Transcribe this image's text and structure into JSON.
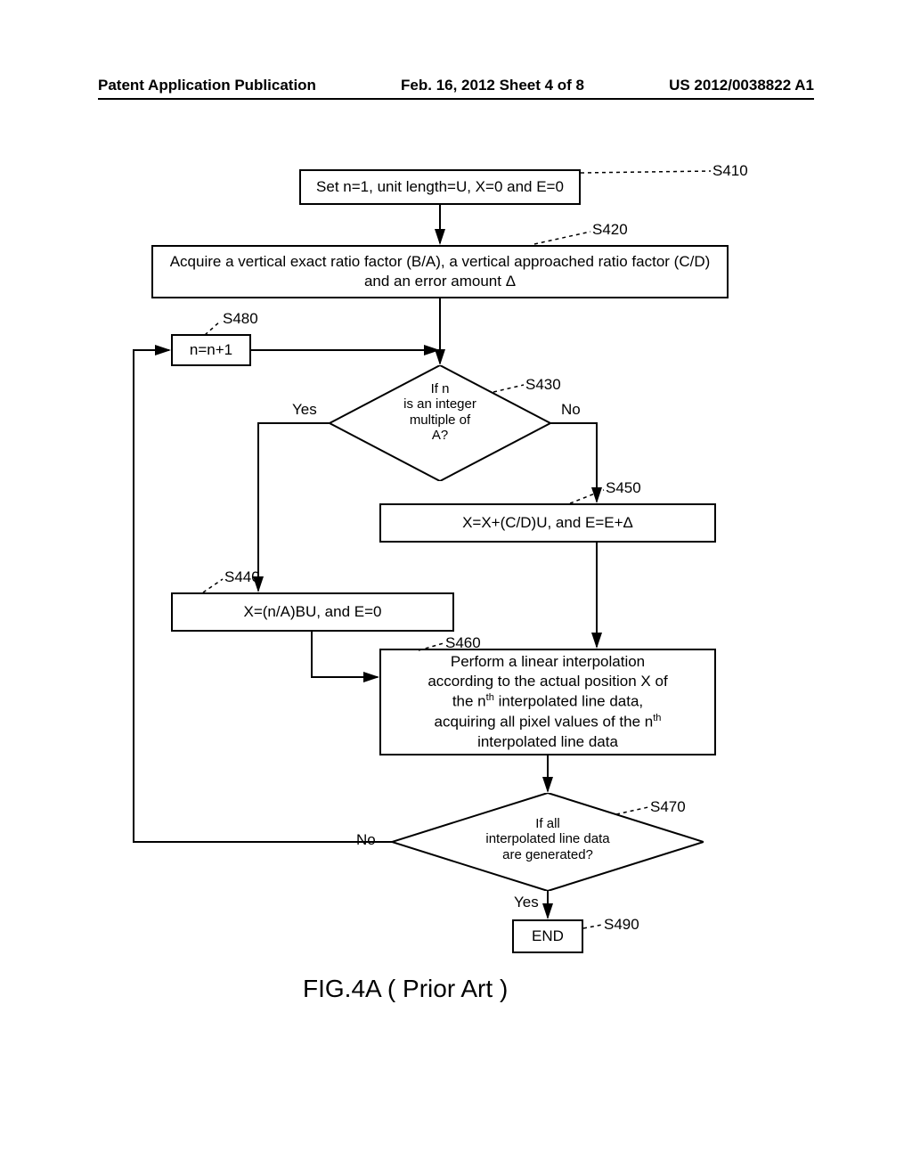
{
  "header": {
    "left": "Patent Application Publication",
    "center": "Feb. 16, 2012  Sheet 4 of 8",
    "right": "US 2012/0038822 A1"
  },
  "labels": {
    "s410": "S410",
    "s420": "S420",
    "s430": "S430",
    "s440": "S440",
    "s450": "S450",
    "s460": "S460",
    "s470": "S470",
    "s480": "S480",
    "s490": "S490"
  },
  "boxes": {
    "s410": "Set n=1, unit length=U, X=0 and E=0",
    "s420": "Acquire a vertical exact ratio factor (B/A), a vertical approached ratio factor (C/D) and an error amount Δ",
    "s440": "X=(n/A)BU, and E=0",
    "s450": "X=X+(C/D)U, and E=E+Δ",
    "s460_l1": "Perform a linear interpolation",
    "s460_l2": "according to the actual position X of",
    "s460_pre": "the n",
    "s460_post": " interpolated line data,",
    "s460_l4": "acquiring all pixel values of the n",
    "s460_l5": "interpolated line data",
    "s480": "n=n+1",
    "s490": "END",
    "th": "th"
  },
  "diamonds": {
    "s430_l1": "If n",
    "s430_l2": "is an integer",
    "s430_l3": "multiple of",
    "s430_l4": "A?",
    "s470_l1": "If all",
    "s470_l2": "interpolated line data",
    "s470_l3": "are generated?"
  },
  "yn": {
    "yes": "Yes",
    "no": "No"
  },
  "caption": "FIG.4A ( Prior Art )"
}
